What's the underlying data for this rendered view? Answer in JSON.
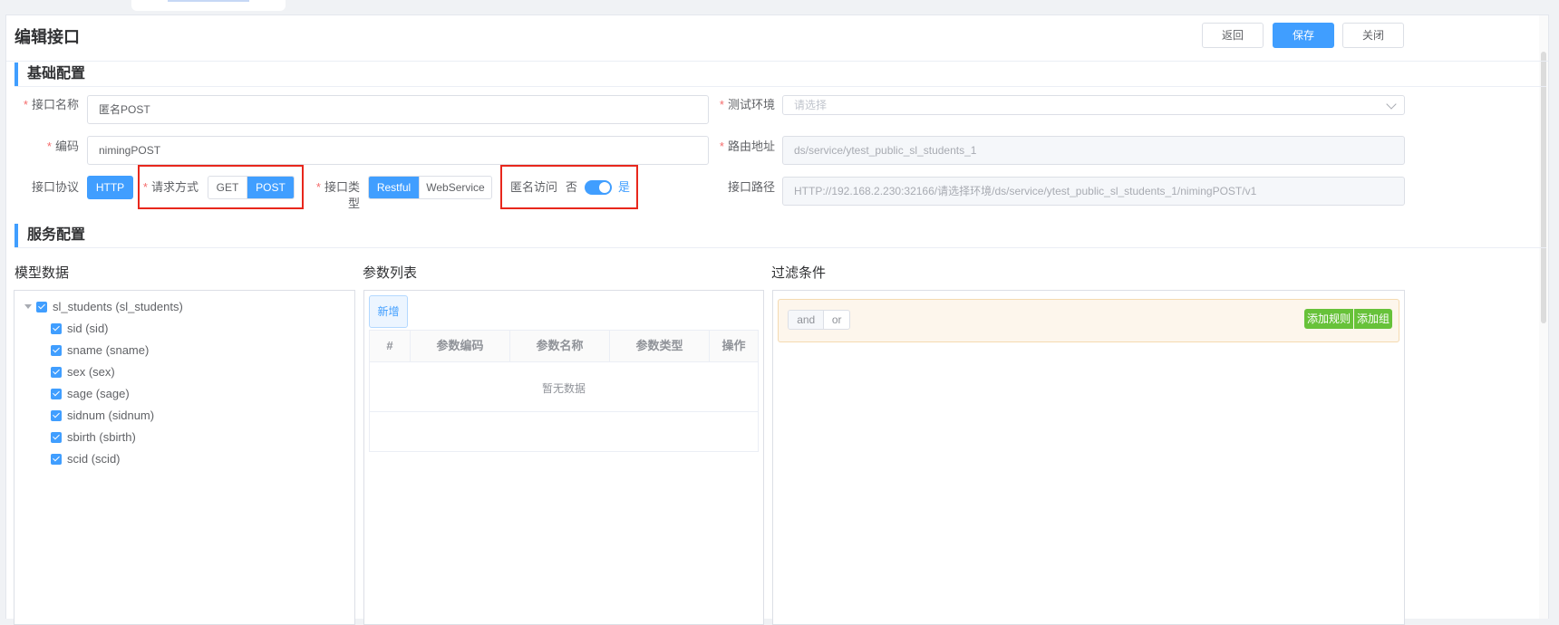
{
  "header": {
    "title": "编辑接口",
    "back_label": "返回",
    "save_label": "保存",
    "close_label": "关闭"
  },
  "basic": {
    "section_title": "基础配置",
    "name_label": "接口名称",
    "name_value": "匿名POST",
    "code_label": "编码",
    "code_value": "nimingPOST",
    "env_label": "测试环境",
    "env_placeholder": "请选择",
    "route_label": "路由地址",
    "route_value": "ds/service/ytest_public_sl_students_1",
    "protocol_label": "接口协议",
    "protocol_value": "HTTP",
    "method_label": "请求方式",
    "methods": [
      "GET",
      "POST"
    ],
    "method_selected": "POST",
    "type_label": "接口类型",
    "types": [
      "Restful",
      "WebService"
    ],
    "type_selected": "Restful",
    "anon_label": "匿名访问",
    "anon_off": "否",
    "anon_on": "是",
    "anon_enabled": true,
    "path_label": "接口路径",
    "path_value": "HTTP://192.168.2.230:32166/请选择环境/ds/service/ytest_public_sl_students_1/nimingPOST/v1"
  },
  "service": {
    "section_title": "服务配置",
    "model_title": "模型数据",
    "params_title": "参数列表",
    "filter_title": "过滤条件",
    "tree": {
      "root": "sl_students (sl_students)",
      "children": [
        "sid (sid)",
        "sname (sname)",
        "sex (sex)",
        "sage (sage)",
        "sidnum (sidnum)",
        "sbirth (sbirth)",
        "scid (scid)"
      ]
    },
    "add_label": "新增",
    "columns": [
      "#",
      "参数编码",
      "参数名称",
      "参数类型",
      "操作"
    ],
    "empty_text": "暂无数据",
    "logic": [
      "and",
      "or"
    ],
    "add_rule_label": "添加规则",
    "add_group_label": "添加组"
  }
}
